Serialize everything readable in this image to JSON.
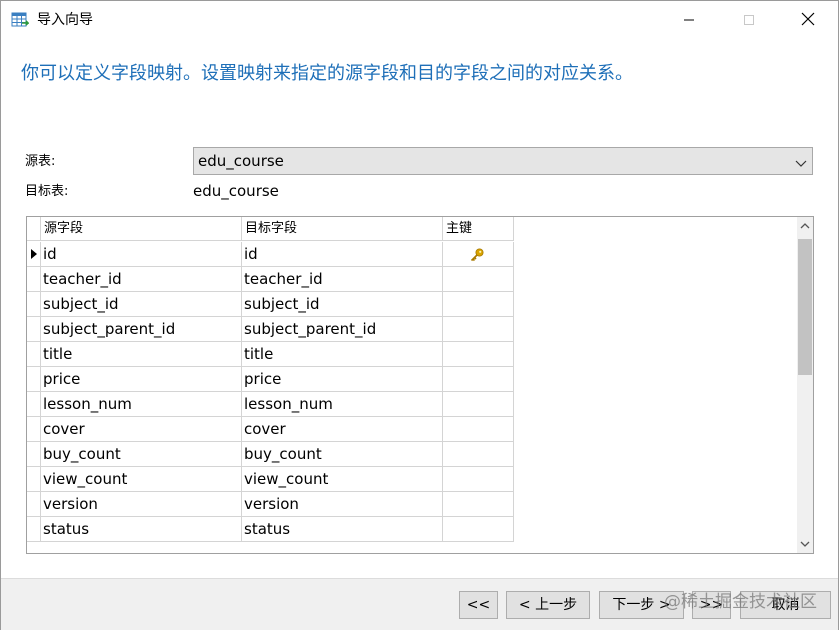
{
  "window": {
    "title": "导入向导",
    "controls": {
      "minimize": "minimize-icon",
      "maximize": "maximize-icon",
      "close": "close-icon"
    }
  },
  "instruction": "你可以定义字段映射。设置映射来指定的源字段和目的字段之间的对应关系。",
  "form": {
    "source_label": "源表:",
    "source_value": "edu_course",
    "target_label": "目标表:",
    "target_value": "edu_course"
  },
  "grid": {
    "headers": {
      "source": "源字段",
      "target": "目标字段",
      "primary_key": "主键"
    },
    "rows": [
      {
        "source": "id",
        "target": "id",
        "pk": true,
        "current": true
      },
      {
        "source": "teacher_id",
        "target": "teacher_id",
        "pk": false
      },
      {
        "source": "subject_id",
        "target": "subject_id",
        "pk": false
      },
      {
        "source": "subject_parent_id",
        "target": "subject_parent_id",
        "pk": false
      },
      {
        "source": "title",
        "target": "title",
        "pk": false
      },
      {
        "source": "price",
        "target": "price",
        "pk": false
      },
      {
        "source": "lesson_num",
        "target": "lesson_num",
        "pk": false
      },
      {
        "source": "cover",
        "target": "cover",
        "pk": false
      },
      {
        "source": "buy_count",
        "target": "buy_count",
        "pk": false
      },
      {
        "source": "view_count",
        "target": "view_count",
        "pk": false
      },
      {
        "source": "version",
        "target": "version",
        "pk": false
      },
      {
        "source": "status",
        "target": "status",
        "pk": false
      }
    ]
  },
  "footer": {
    "first": "<<",
    "prev": "< 上一步",
    "next": "下一步 >",
    "last": ">>",
    "cancel": "取消"
  },
  "watermark": "@稀土掘金技术社区",
  "colors": {
    "instruction": "#1e6fb8",
    "key_icon": "#d9a400",
    "footer_bg": "#f0f0f0",
    "select_bg": "#e5e5e5"
  }
}
